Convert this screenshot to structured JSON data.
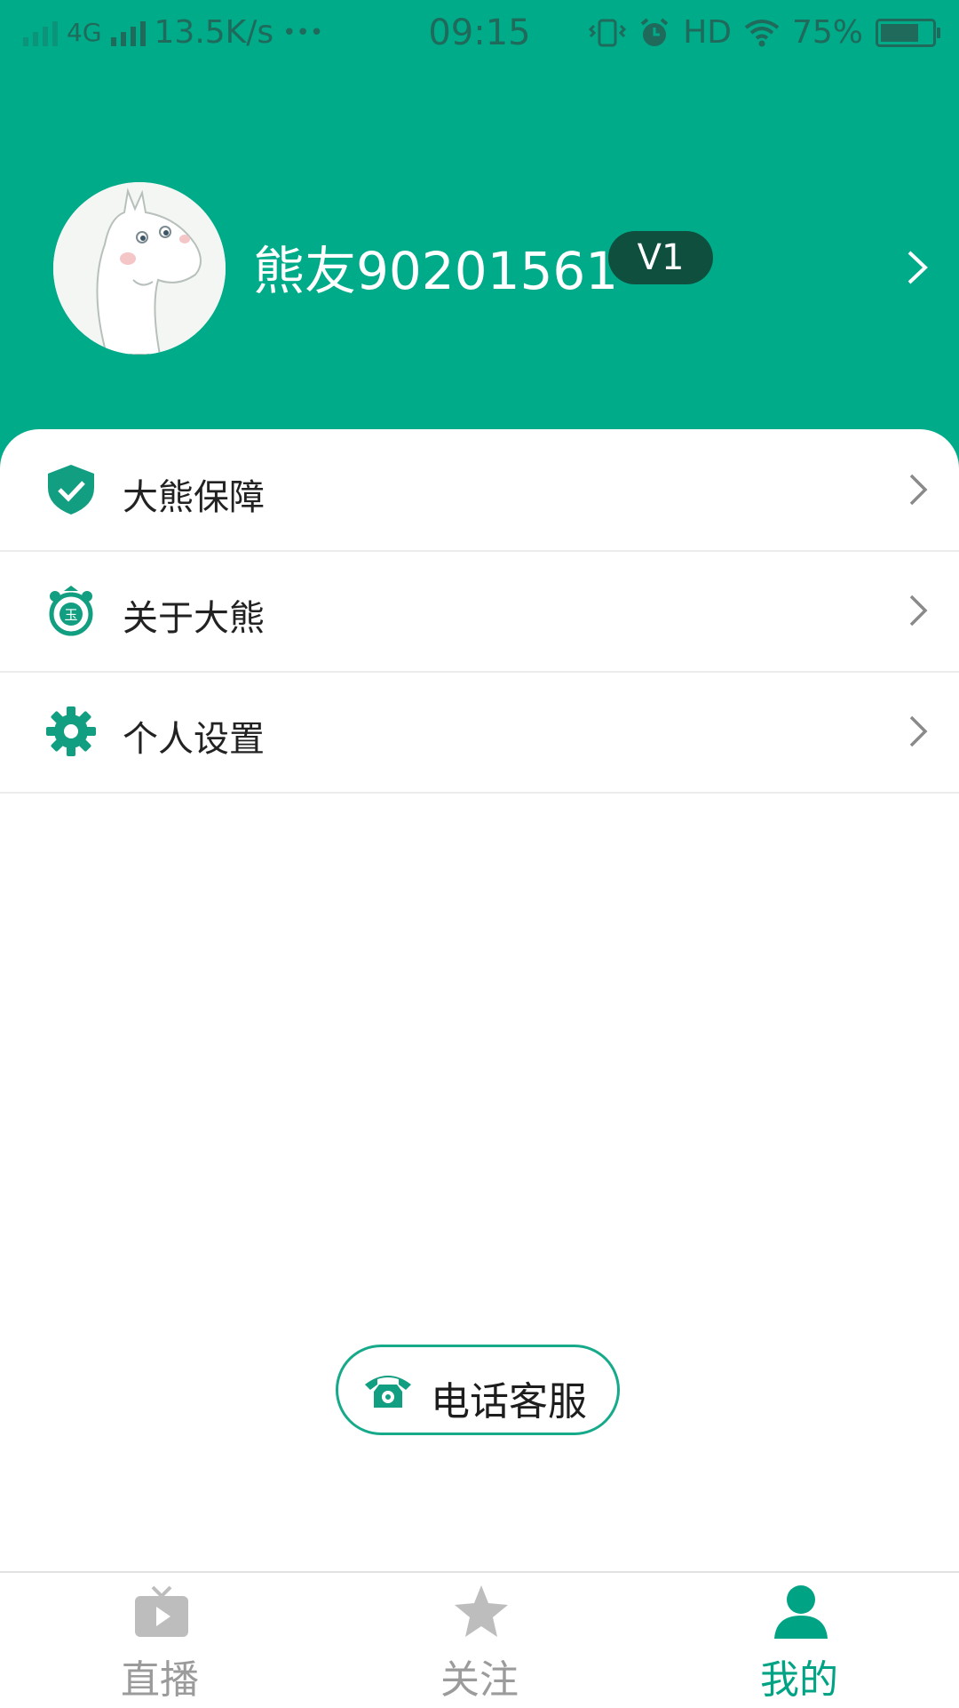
{
  "status_bar": {
    "network": "4G",
    "speed": "13.5K/s",
    "more": "•••",
    "time": "09:15",
    "hd": "HD",
    "battery": "75%",
    "battery_level": 0.75
  },
  "profile": {
    "username": "熊友90201561",
    "level": "V1"
  },
  "menu": {
    "items": [
      {
        "label": "大熊保障",
        "icon": "shield-check-icon"
      },
      {
        "label": "关于大熊",
        "icon": "bear-badge-icon"
      },
      {
        "label": "个人设置",
        "icon": "gear-icon"
      }
    ]
  },
  "service_button": {
    "label": "电话客服",
    "icon": "telephone-icon"
  },
  "tabs": [
    {
      "label": "直播",
      "icon": "tv-icon",
      "active": false
    },
    {
      "label": "关注",
      "icon": "star-icon",
      "active": false
    },
    {
      "label": "我的",
      "icon": "person-icon",
      "active": true
    }
  ],
  "colors": {
    "brand": "#00ab8a",
    "level_badge": "#0e4f3e",
    "tab_active": "#00a383",
    "tab_inactive": "#9b9b9b"
  }
}
